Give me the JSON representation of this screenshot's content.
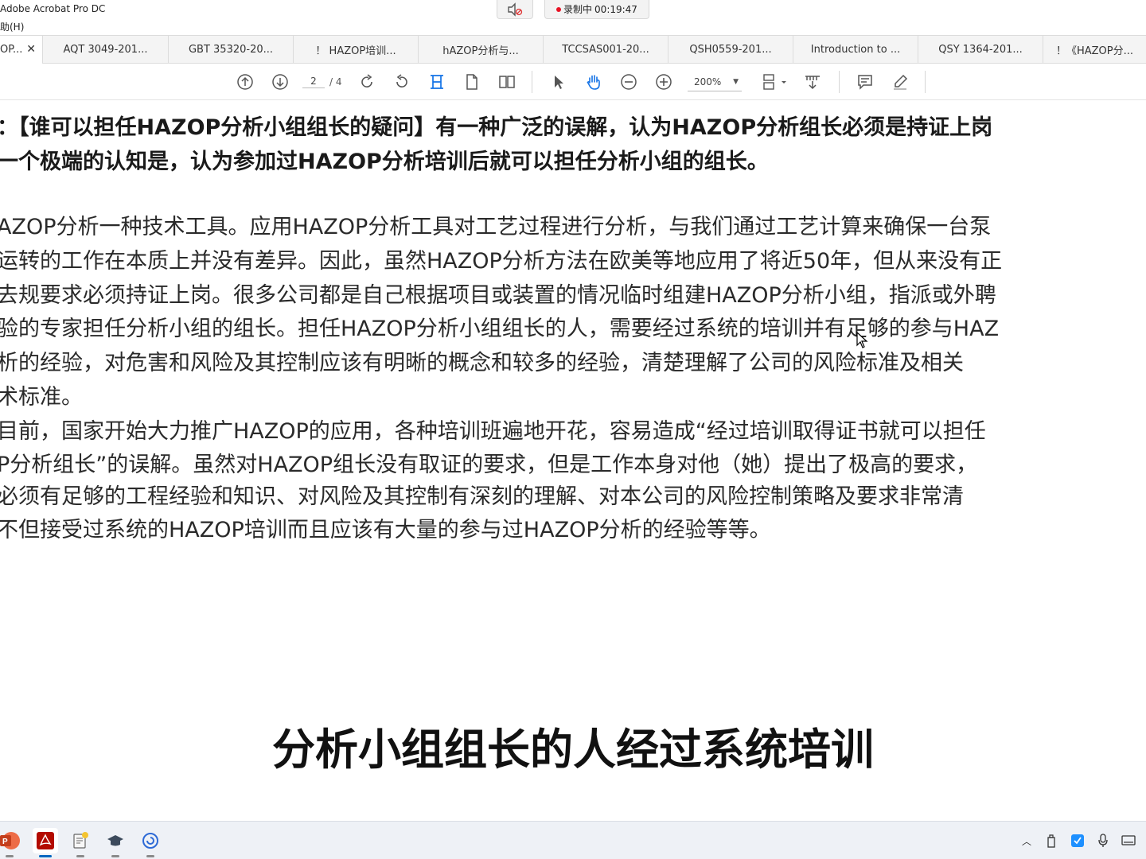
{
  "window": {
    "app_title": "Adobe Acrobat Pro DC",
    "menu_help": "助(H)"
  },
  "recording": {
    "status": "录制中",
    "timer": "00:19:47"
  },
  "tabs": [
    {
      "label": "OP...",
      "active": true
    },
    {
      "label": "AQT 3049-201..."
    },
    {
      "label": "GBT 35320-20..."
    },
    {
      "label": "！ HAZOP培训..."
    },
    {
      "label": "hAZOP分析与..."
    },
    {
      "label": "TCCSAS001-20..."
    },
    {
      "label": "QSH0559-201..."
    },
    {
      "label": "Introduction to ..."
    },
    {
      "label": "QSY 1364-201..."
    },
    {
      "label": "！《HAZOP分..."
    }
  ],
  "toolbar": {
    "page_current": "2",
    "page_total": "/ 4",
    "zoom": "200%"
  },
  "document": {
    "lines": [
      "：【谁可以担任HAZOP分析小组组长的疑问】有一种广泛的误解，认为HAZOP分析组长必须是持证上岗",
      "一个极端的认知是，认为参加过HAZOP分析培训后就可以担任分析小组的组长。",
      "AZOP分析一种技术工具。应用HAZOP分析工具对工艺过程进行分析，与我们通过工艺计算来确保一台泵",
      "运转的工作在本质上并没有差异。因此，虽然HAZOP分析方法在欧美等地应用了将近50年，但从来没有正",
      "去规要求必须持证上岗。很多公司都是自己根据项目或装置的情况临时组建HAZOP分析小组，指派或外聘",
      "验的专家担任分析小组的组长。担任HAZOP分析小组组长的人，需要经过系统的培训并有足够的参与HAZ",
      "析的经验，对危害和风险及其控制应该有明晰的概念和较多的经验，清楚理解了公司的风险标准及相关",
      "术标准。",
      "目前，国家开始大力推广HAZOP的应用，各种培训班遍地开花，容易造成“经过培训取得证书就可以担任",
      "P分析组长”的误解。虽然对HAZOP组长没有取证的要求，但是工作本身对他（她）提出了极高的要求，",
      "必须有足够的工程经验和知识、对风险及其控制有深刻的理解、对本公司的风险控制策略及要求非常清",
      "不但接受过系统的HAZOP培训而且应该有大量的参与过HAZOP分析的经验等等。"
    ],
    "subtitle": "分析小组组长的人经过系统培训"
  },
  "taskbar": {
    "apps": [
      "powerpoint-icon",
      "acrobat-icon",
      "notes-icon",
      "graduation-icon",
      "browser-icon"
    ]
  }
}
